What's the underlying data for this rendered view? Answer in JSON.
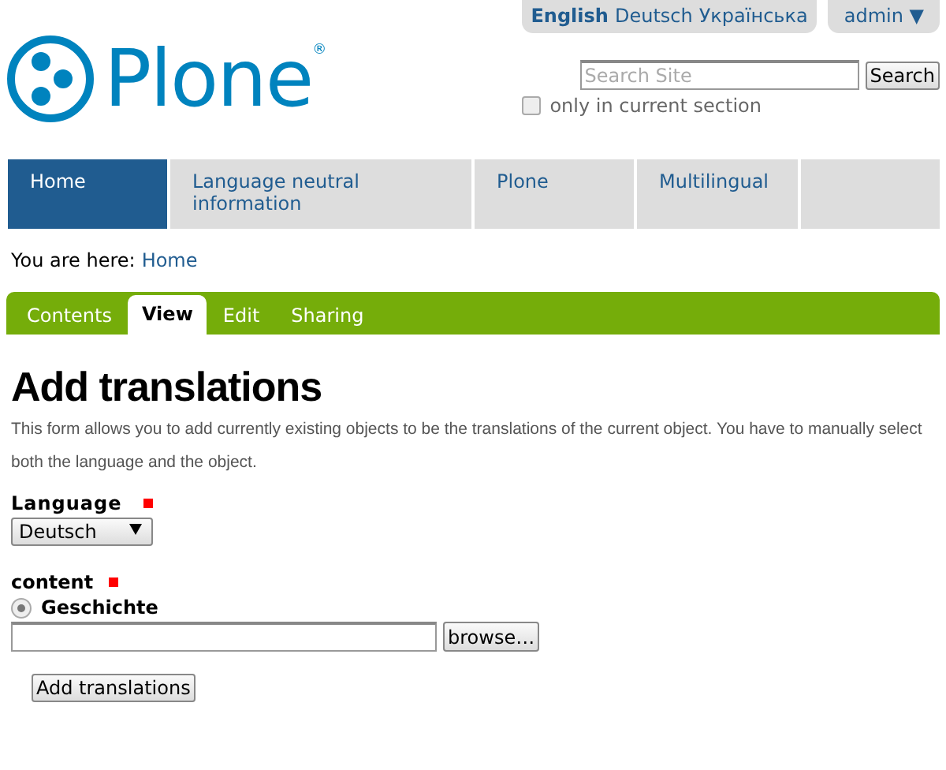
{
  "languages": [
    {
      "label": "English",
      "selected": true
    },
    {
      "label": "Deutsch",
      "selected": false
    },
    {
      "label": "Українська",
      "selected": false
    }
  ],
  "user_menu": {
    "label": "admin ▼"
  },
  "logo": {
    "text": "Plone",
    "mark": "®"
  },
  "search": {
    "placeholder": "Search Site",
    "button": "Search",
    "option": {
      "label": "only in current section",
      "checked": false
    }
  },
  "nav": [
    {
      "label": "Home",
      "selected": true
    },
    {
      "label": "Language neutral information",
      "selected": false
    },
    {
      "label": "Plone",
      "selected": false
    },
    {
      "label": "Multilingual",
      "selected": false
    }
  ],
  "breadcrumb": {
    "prefix": "You are here:",
    "link": "Home"
  },
  "edit_tabs": [
    {
      "label": "Contents",
      "selected": false
    },
    {
      "label": "View",
      "selected": true
    },
    {
      "label": "Edit",
      "selected": false
    },
    {
      "label": "Sharing",
      "selected": false
    }
  ],
  "title": "Add translations",
  "description": "This form allows you to add currently existing objects to be the translations of the current object. You have to manually select both the language and the object.",
  "fields": [
    {
      "kind": "select",
      "label": "Language",
      "required": true,
      "value": "Deutsch"
    },
    {
      "kind": "content",
      "label": "content",
      "required": true,
      "option": {
        "label": "Geschichte",
        "checked": true
      },
      "browse": "browse…"
    }
  ],
  "submit": "Add translations"
}
